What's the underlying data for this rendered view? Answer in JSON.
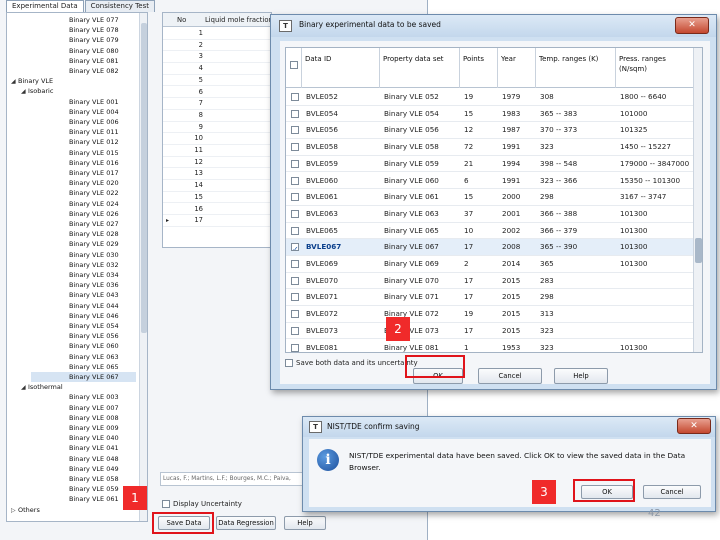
{
  "main": {
    "tabs": [
      "Experimental Data",
      "Consistency Test"
    ],
    "tree": [
      {
        "label": "Binary VLE 077",
        "depth": 2
      },
      {
        "label": "Binary VLE 078",
        "depth": 2
      },
      {
        "label": "Binary VLE 079",
        "depth": 2
      },
      {
        "label": "Binary VLE 080",
        "depth": 2
      },
      {
        "label": "Binary VLE 081",
        "depth": 2
      },
      {
        "label": "Binary VLE 082",
        "depth": 2
      },
      {
        "label": "Binary VLE",
        "depth": 0,
        "toggle": "◢"
      },
      {
        "label": "Isobaric",
        "depth": 1,
        "toggle": "◢"
      },
      {
        "label": "Binary VLE 001",
        "depth": 2
      },
      {
        "label": "Binary VLE 004",
        "depth": 2
      },
      {
        "label": "Binary VLE 006",
        "depth": 2
      },
      {
        "label": "Binary VLE 011",
        "depth": 2
      },
      {
        "label": "Binary VLE 012",
        "depth": 2
      },
      {
        "label": "Binary VLE 015",
        "depth": 2
      },
      {
        "label": "Binary VLE 016",
        "depth": 2
      },
      {
        "label": "Binary VLE 017",
        "depth": 2
      },
      {
        "label": "Binary VLE 020",
        "depth": 2
      },
      {
        "label": "Binary VLE 022",
        "depth": 2
      },
      {
        "label": "Binary VLE 024",
        "depth": 2
      },
      {
        "label": "Binary VLE 026",
        "depth": 2
      },
      {
        "label": "Binary VLE 027",
        "depth": 2
      },
      {
        "label": "Binary VLE 028",
        "depth": 2
      },
      {
        "label": "Binary VLE 029",
        "depth": 2
      },
      {
        "label": "Binary VLE 030",
        "depth": 2
      },
      {
        "label": "Binary VLE 032",
        "depth": 2
      },
      {
        "label": "Binary VLE 034",
        "depth": 2
      },
      {
        "label": "Binary VLE 036",
        "depth": 2
      },
      {
        "label": "Binary VLE 043",
        "depth": 2
      },
      {
        "label": "Binary VLE 044",
        "depth": 2
      },
      {
        "label": "Binary VLE 046",
        "depth": 2
      },
      {
        "label": "Binary VLE 054",
        "depth": 2
      },
      {
        "label": "Binary VLE 056",
        "depth": 2
      },
      {
        "label": "Binary VLE 060",
        "depth": 2
      },
      {
        "label": "Binary VLE 063",
        "depth": 2
      },
      {
        "label": "Binary VLE 065",
        "depth": 2
      },
      {
        "label": "Binary VLE 067",
        "depth": 2,
        "selected": true
      },
      {
        "label": "Isothermal",
        "depth": 1,
        "toggle": "◢"
      },
      {
        "label": "Binary VLE 003",
        "depth": 2
      },
      {
        "label": "Binary VLE 007",
        "depth": 2
      },
      {
        "label": "Binary VLE 008",
        "depth": 2
      },
      {
        "label": "Binary VLE 009",
        "depth": 2
      },
      {
        "label": "Binary VLE 040",
        "depth": 2
      },
      {
        "label": "Binary VLE 041",
        "depth": 2
      },
      {
        "label": "Binary VLE 048",
        "depth": 2
      },
      {
        "label": "Binary VLE 049",
        "depth": 2
      },
      {
        "label": "Binary VLE 058",
        "depth": 2
      },
      {
        "label": "Binary VLE 059",
        "depth": 2
      },
      {
        "label": "Binary VLE 061",
        "depth": 2
      },
      {
        "label": "Others",
        "depth": 0,
        "toggle": "▷"
      }
    ],
    "grid": {
      "col_no": "No",
      "col_liquid": "Liquid mole fraction",
      "rows": [
        "1",
        "2",
        "3",
        "4",
        "5",
        "6",
        "7",
        "8",
        "9",
        "10",
        "11",
        "12",
        "13",
        "14",
        "15",
        "16",
        "17"
      ],
      "current_row_marker": "▸"
    },
    "reference_text": "Lucas, F.; Martins, L.F.; Bourges, M.C.; Paiva,",
    "display_uncertainty": "Display Uncertainty",
    "buttons": {
      "save_data": "Save Data",
      "data_regression": "Data Regression",
      "help": "Help"
    }
  },
  "dialog1": {
    "title": "Binary experimental data to be saved",
    "icon_letter": "T",
    "close": "✕",
    "columns": [
      "Data ID",
      "Property data set",
      "Points",
      "Year",
      "Temp. ranges (K)",
      "Press. ranges (N/sqm)"
    ],
    "rows": [
      {
        "checked": false,
        "id": "BVLE052",
        "set": "Binary VLE 052",
        "points": "19",
        "year": "1979",
        "temp": "308",
        "press": "1800 -- 6640"
      },
      {
        "checked": false,
        "id": "BVLE054",
        "set": "Binary VLE 054",
        "points": "15",
        "year": "1983",
        "temp": "365 -- 383",
        "press": "101000"
      },
      {
        "checked": false,
        "id": "BVLE056",
        "set": "Binary VLE 056",
        "points": "12",
        "year": "1987",
        "temp": "370 -- 373",
        "press": "101325"
      },
      {
        "checked": false,
        "id": "BVLE058",
        "set": "Binary VLE 058",
        "points": "72",
        "year": "1991",
        "temp": "323",
        "press": "1450 -- 15227"
      },
      {
        "checked": false,
        "id": "BVLE059",
        "set": "Binary VLE 059",
        "points": "21",
        "year": "1994",
        "temp": "398 -- 548",
        "press": "179000 -- 3847000"
      },
      {
        "checked": false,
        "id": "BVLE060",
        "set": "Binary VLE 060",
        "points": "6",
        "year": "1991",
        "temp": "323 -- 366",
        "press": "15350 -- 101300"
      },
      {
        "checked": false,
        "id": "BVLE061",
        "set": "Binary VLE 061",
        "points": "15",
        "year": "2000",
        "temp": "298",
        "press": "3167 -- 3747"
      },
      {
        "checked": false,
        "id": "BVLE063",
        "set": "Binary VLE 063",
        "points": "37",
        "year": "2001",
        "temp": "366 -- 388",
        "press": "101300"
      },
      {
        "checked": false,
        "id": "BVLE065",
        "set": "Binary VLE 065",
        "points": "10",
        "year": "2002",
        "temp": "366 -- 379",
        "press": "101300"
      },
      {
        "checked": true,
        "id": "BVLE067",
        "set": "Binary VLE 067",
        "points": "17",
        "year": "2008",
        "temp": "365 -- 390",
        "press": "101300",
        "selected": true
      },
      {
        "checked": false,
        "id": "BVLE069",
        "set": "Binary VLE 069",
        "points": "2",
        "year": "2014",
        "temp": "365",
        "press": "101300"
      },
      {
        "checked": false,
        "id": "BVLE070",
        "set": "Binary VLE 070",
        "points": "17",
        "year": "2015",
        "temp": "283",
        "press": ""
      },
      {
        "checked": false,
        "id": "BVLE071",
        "set": "Binary VLE 071",
        "points": "17",
        "year": "2015",
        "temp": "298",
        "press": ""
      },
      {
        "checked": false,
        "id": "BVLE072",
        "set": "Binary VLE 072",
        "points": "19",
        "year": "2015",
        "temp": "313",
        "press": ""
      },
      {
        "checked": false,
        "id": "BVLE073",
        "set": "Binary VLE 073",
        "points": "17",
        "year": "2015",
        "temp": "323",
        "press": ""
      },
      {
        "checked": false,
        "id": "BVLE081",
        "set": "Binary VLE 081",
        "points": "1",
        "year": "1953",
        "temp": "323",
        "press": "101300"
      }
    ],
    "save_both": "Save both data and its uncertainty",
    "ok": "OK",
    "cancel": "Cancel",
    "help": "Help"
  },
  "dialog2": {
    "title": "NIST/TDE confirm saving",
    "message": "NIST/TDE experimental data have been saved. Click OK to view the saved data in the Data Browser.",
    "info_glyph": "i",
    "close": "✕",
    "ok": "OK",
    "cancel": "Cancel"
  },
  "callouts": [
    "1",
    "2",
    "3"
  ],
  "page_number": "42",
  "colors": {
    "highlight_red": "#e0141b",
    "callout_red": "#f02a2a",
    "dialog_frame": "#cfe0f1",
    "selection": "#d6e4f3"
  }
}
